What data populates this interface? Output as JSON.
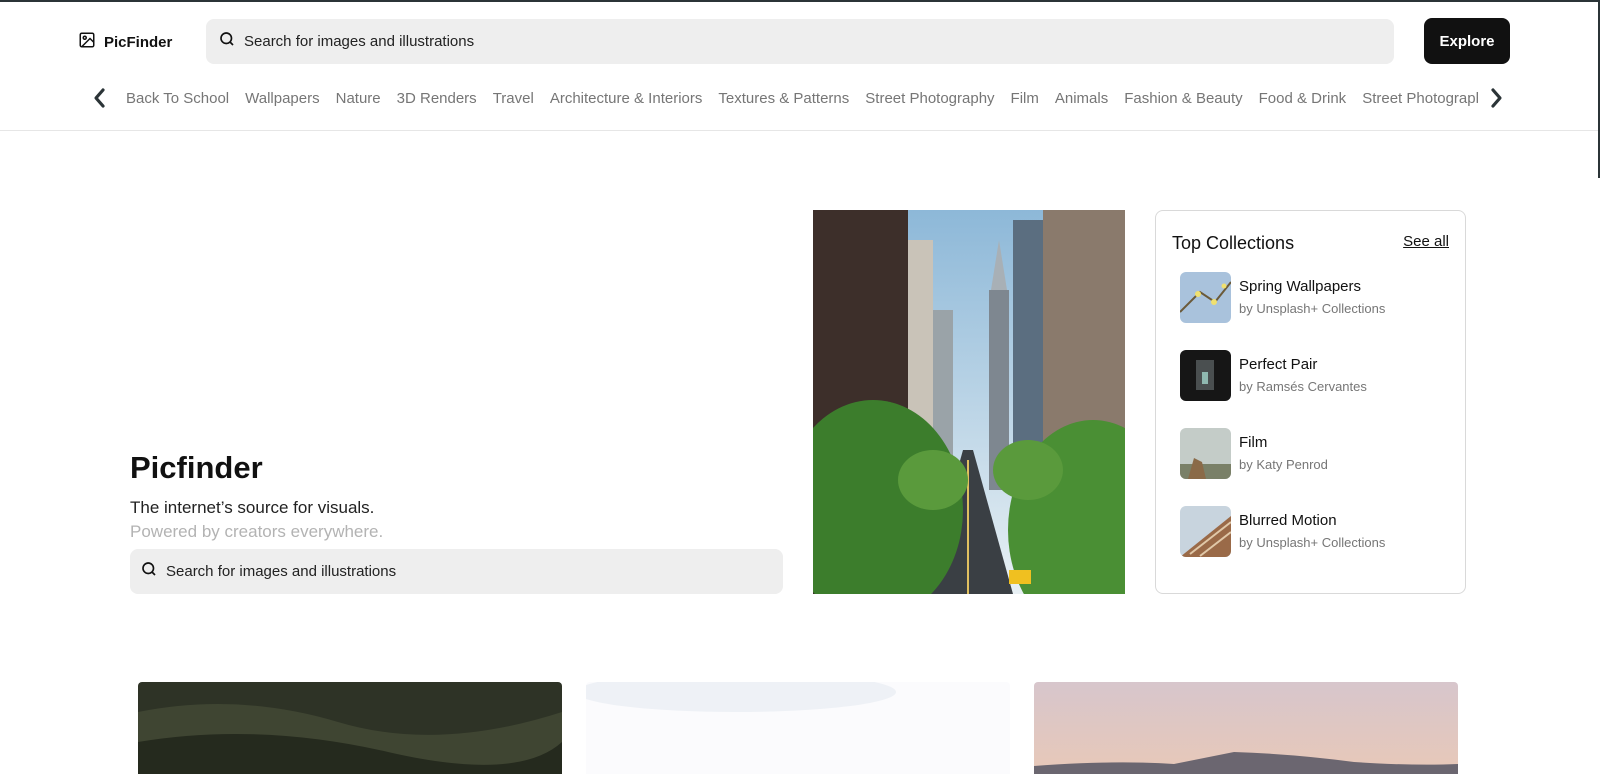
{
  "header": {
    "logo_text": "PicFinder",
    "search_placeholder": "Search for images and illustrations",
    "explore_label": "Explore"
  },
  "categories": [
    "Back To School",
    "Wallpapers",
    "Nature",
    "3D Renders",
    "Travel",
    "Architecture & Interiors",
    "Textures & Patterns",
    "Street Photography",
    "Film",
    "Animals",
    "Fashion & Beauty",
    "Food & Drink",
    "Street Photography"
  ],
  "hero": {
    "title": "Picfinder",
    "tagline": "The internet’s source for visuals.",
    "subtagline": "Powered by creators everywhere.",
    "search_placeholder": "Search for images and illustrations"
  },
  "collections": {
    "heading": "Top Collections",
    "see_all": "See all",
    "items": [
      {
        "name": "Spring Wallpapers",
        "by": "by Unsplash+ Collections"
      },
      {
        "name": "Perfect Pair",
        "by": "by Ramsés Cervantes"
      },
      {
        "name": "Film",
        "by": "by Katy Penrod"
      },
      {
        "name": "Blurred Motion",
        "by": "by Unsplash+ Collections"
      }
    ]
  },
  "colors": {
    "accent": "#111111",
    "search_bg": "#eeeeee",
    "muted_text": "#767676",
    "faint_text": "#b3b3b3"
  },
  "icons": [
    "image-icon",
    "search-icon",
    "chevron-left-icon",
    "chevron-right-icon"
  ]
}
